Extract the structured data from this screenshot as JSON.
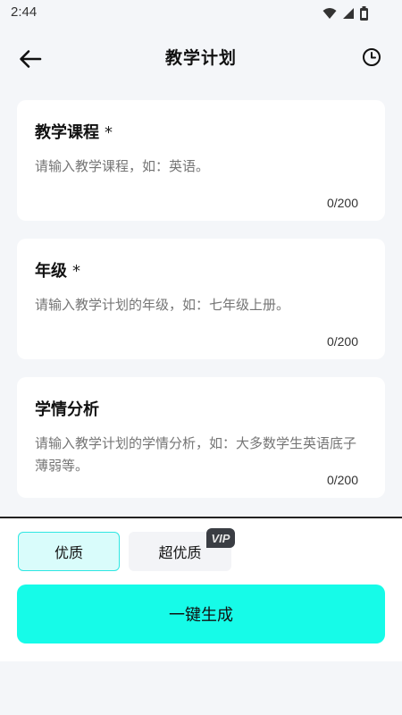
{
  "status_bar": {
    "time": "2:44"
  },
  "header": {
    "title": "教学计划",
    "back_icon": "arrow-left-icon",
    "history_icon": "clock-icon"
  },
  "fields": [
    {
      "label": "教学课程",
      "required_mark": "*",
      "placeholder": "请输入教学课程，如：英语。",
      "count": "0/200"
    },
    {
      "label": "年级",
      "required_mark": "*",
      "placeholder": "请输入教学计划的年级，如：七年级上册。",
      "count": "0/200"
    },
    {
      "label": "学情分析",
      "required_mark": "",
      "placeholder": "请输入教学计划的学情分析，如：大多数学生英语底子薄弱等。",
      "count": "0/200"
    }
  ],
  "quality": {
    "options": [
      {
        "label": "优质",
        "selected": true
      },
      {
        "label": "超优质",
        "selected": false,
        "badge": "VIP"
      }
    ]
  },
  "actions": {
    "generate_label": "一键生成"
  },
  "colors": {
    "accent": "#16fbe8",
    "selected_bg": "#d9fcfb",
    "selected_border": "#2ee7e2",
    "page_bg": "#f4f6f9"
  }
}
